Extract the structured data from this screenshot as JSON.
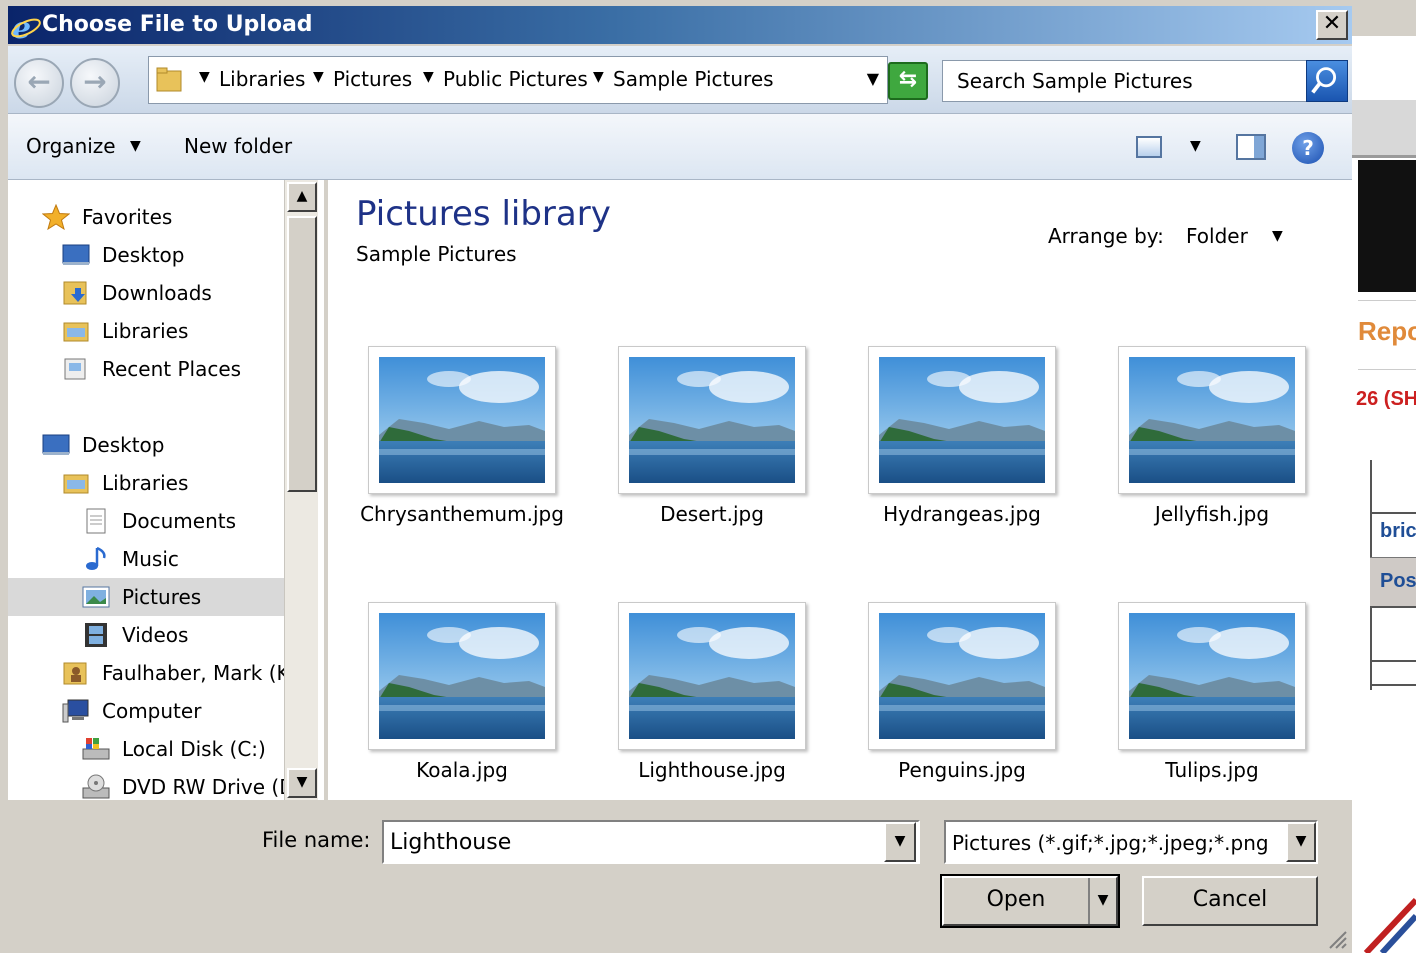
{
  "window": {
    "title": "Choose File to Upload",
    "close_glyph": "✕"
  },
  "address": {
    "crumbs": [
      "Libraries",
      "Pictures",
      "Public Pictures",
      "Sample Pictures"
    ],
    "search_placeholder": "Search Sample Pictures"
  },
  "toolbar": {
    "organize_label": "Organize",
    "new_folder_label": "New folder"
  },
  "nav": {
    "items": [
      {
        "label": "Favorites",
        "icon": "star-icon"
      },
      {
        "label": "Desktop",
        "icon": "desktop-icon"
      },
      {
        "label": "Downloads",
        "icon": "downloads-folder-icon"
      },
      {
        "label": "Libraries",
        "icon": "libraries-icon"
      },
      {
        "label": "Recent Places",
        "icon": "recent-places-icon"
      },
      {
        "label": "Desktop",
        "icon": "desktop-icon"
      },
      {
        "label": "Libraries",
        "icon": "libraries-icon"
      },
      {
        "label": "Documents",
        "icon": "document-icon"
      },
      {
        "label": "Music",
        "icon": "music-note-icon"
      },
      {
        "label": "Pictures",
        "icon": "pictures-icon"
      },
      {
        "label": "Videos",
        "icon": "film-icon"
      },
      {
        "label": "Faulhaber, Mark (K",
        "icon": "user-folder-icon"
      },
      {
        "label": "Computer",
        "icon": "computer-icon"
      },
      {
        "label": "Local Disk (C:)",
        "icon": "hard-disk-icon"
      },
      {
        "label": "DVD RW Drive (D",
        "icon": "dvd-drive-icon"
      }
    ]
  },
  "content": {
    "library_title": "Pictures library",
    "subtitle": "Sample Pictures",
    "arrange_label": "Arrange by:",
    "arrange_value": "Folder",
    "files": [
      "Chrysanthemum.jpg",
      "Desert.jpg",
      "Hydrangeas.jpg",
      "Jellyfish.jpg",
      "Koala.jpg",
      "Lighthouse.jpg",
      "Penguins.jpg",
      "Tulips.jpg"
    ]
  },
  "bottom": {
    "file_name_label": "File name:",
    "file_name_value": "Lighthouse",
    "file_type_value": "Pictures (*.gif;*.jpg;*.jpeg;*.png",
    "open_label": "Open",
    "cancel_label": "Cancel"
  },
  "background_page": {
    "repo_text": "Repo",
    "red_text": "26 (SH",
    "bri_text": "bric",
    "pos_text": "Pos"
  },
  "colors": {
    "title_gradient_start": "#0a246a",
    "library_title": "#1e3287",
    "selected_nav": "#d9d9d9"
  }
}
